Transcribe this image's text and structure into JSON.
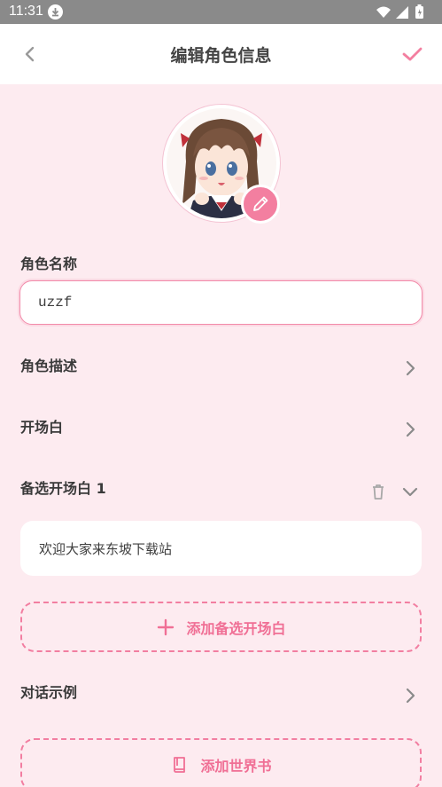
{
  "status": {
    "time": "11:31"
  },
  "header": {
    "title": "编辑角色信息"
  },
  "name_section": {
    "label": "角色名称",
    "value": "uzzf"
  },
  "description_section": {
    "label": "角色描述"
  },
  "opening_section": {
    "label": "开场白"
  },
  "alt_opening": {
    "label": "备选开场白 1",
    "text": "欢迎大家来东坡下载站"
  },
  "add_alt_button": {
    "label": "添加备选开场白"
  },
  "dialog_example": {
    "label": "对话示例"
  },
  "add_worldbook_button": {
    "label": "添加世界书"
  },
  "colors": {
    "accent": "#f37fa0",
    "background": "#fdebf0"
  }
}
